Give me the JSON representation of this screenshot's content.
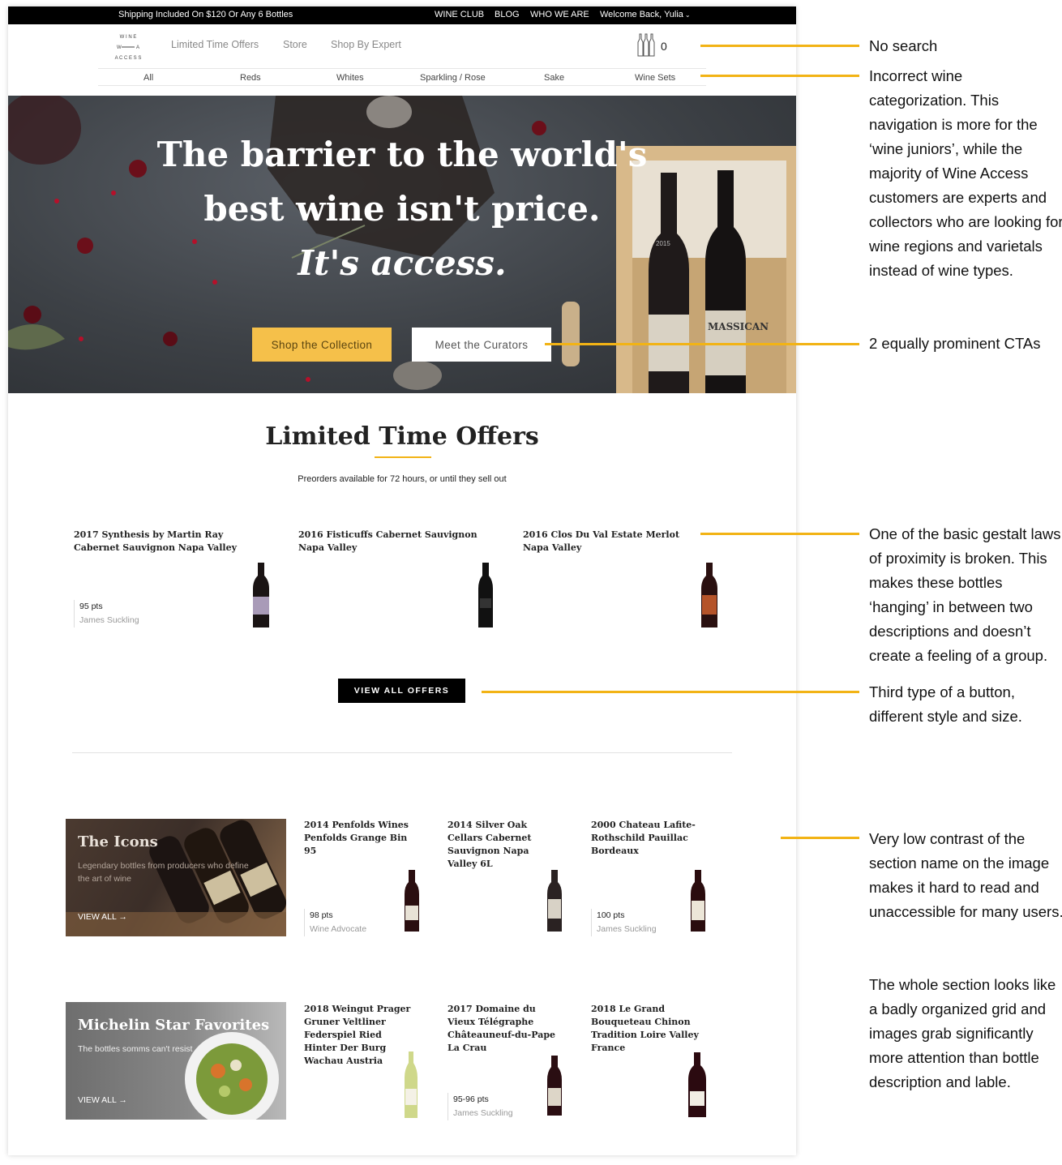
{
  "topbar": {
    "shipping": "Shipping Included On $120 Or Any 6 Bottles",
    "links": [
      "WINE CLUB",
      "BLOG",
      "WHO WE ARE"
    ],
    "welcome": "Welcome Back, Yulia"
  },
  "header": {
    "logo_text": "WINE ACCESS",
    "nav": [
      "Limited Time Offers",
      "Store",
      "Shop By Expert"
    ],
    "cart_count": "0",
    "categories": [
      "All",
      "Reds",
      "Whites",
      "Sparkling / Rose",
      "Sake",
      "Wine Sets"
    ]
  },
  "hero": {
    "line1": "The barrier to the world's",
    "line2": "best wine isn't price.",
    "line3": "It's access.",
    "cta_primary": "Shop the Collection",
    "cta_secondary": "Meet the Curators",
    "bottle_label_left": "2015",
    "bottle_label_right": "MASSICAN"
  },
  "offers": {
    "title": "Limited Time Offers",
    "subtitle": "Preorders available for 72 hours, or until they sell out",
    "products": [
      {
        "name_line1": "2017 Synthesis by Martin Ray",
        "name_line2": "Cabernet Sauvignon Napa Valley",
        "pts": "95 pts",
        "source": "James Suckling"
      },
      {
        "name_line1": "2016 Fisticuffs Cabernet Sauvignon",
        "name_line2": "Napa Valley"
      },
      {
        "name_line1": "2016 Clos Du Val Estate Merlot",
        "name_line2": "Napa Valley"
      }
    ],
    "view_all": "VIEW ALL OFFERS"
  },
  "collections": [
    {
      "title": "The Icons",
      "subtitle_line1": "Legendary bottles from producers who define",
      "subtitle_line2": "the art of wine",
      "view_all": "VIEW ALL",
      "products": [
        {
          "lines": [
            "2014 Penfolds Wines",
            "Penfolds Grange Bin",
            "95"
          ],
          "pts": "98 pts",
          "source": "Wine Advocate"
        },
        {
          "lines": [
            "2014 Silver Oak",
            "Cellars Cabernet",
            "Sauvignon Napa",
            "Valley 6L"
          ]
        },
        {
          "lines": [
            "2000 Chateau Lafite-",
            "Rothschild Pauillac",
            "Bordeaux"
          ],
          "pts": "100 pts",
          "source": "James Suckling"
        }
      ]
    },
    {
      "title": "Michelin Star Favorites",
      "subtitle_line1": "The bottles somms can't resist",
      "view_all": "VIEW ALL",
      "products": [
        {
          "lines": [
            "2018 Weingut Prager",
            "Gruner Veltliner",
            "Federspiel Ried",
            "Hinter Der Burg",
            "Wachau Austria"
          ]
        },
        {
          "lines": [
            "2017 Domaine du",
            "Vieux Télégraphe",
            "Châteauneuf-du-Pape",
            "La Crau"
          ],
          "pts": "95-96 pts",
          "source": "James Suckling"
        },
        {
          "lines": [
            "2018 Le Grand",
            "Bouqueteau Chinon",
            "Tradition Loire Valley",
            "France"
          ]
        }
      ]
    }
  ],
  "annotations": {
    "no_search": "No search",
    "categorization": "Incorrect wine categorization. This navigation is more for the ‘wine juniors’, while the majority of Wine Access customers are experts and collectors who are looking for wine regions and varietals instead of wine types.",
    "ctas": "2 equally prominent CTAs",
    "proximity": "One of the basic gestalt laws of proximity is broken. This makes these bottles ‘hanging’ in between two descriptions and doesn’t create a feeling of a group.",
    "button_type": "Third type of a button, different style and size.",
    "contrast": "Very low contrast of the section name on the image makes it hard to read and unaccessible for many users.",
    "grid": "The whole section looks like a badly organized grid and images grab significantly more attention than bottle description and lable."
  },
  "colors": {
    "annotation_line": "#f2b315",
    "cta_gold": "#f5c04a",
    "topbar": "#000000"
  }
}
